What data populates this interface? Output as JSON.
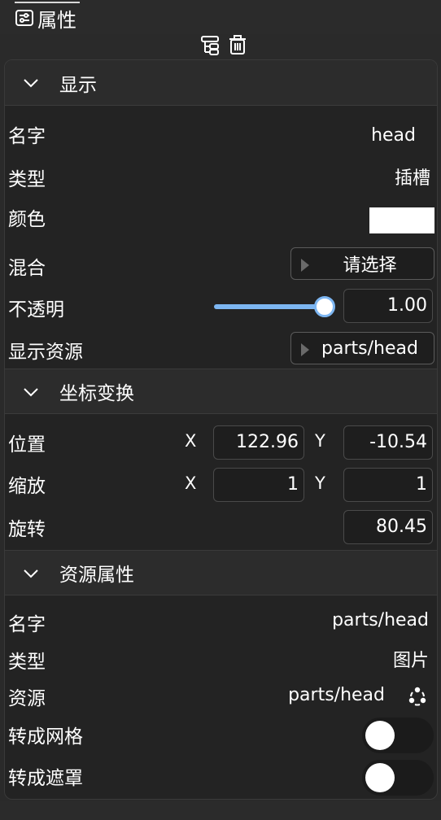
{
  "tab": {
    "label": "属性"
  },
  "sections": {
    "display": {
      "title": "显示",
      "name_label": "名字",
      "name_value": "head",
      "type_label": "类型",
      "type_value": "插槽",
      "color_label": "颜色",
      "color_value": "#ffffff",
      "blend_label": "混合",
      "blend_value": "请选择",
      "opacity_label": "不透明",
      "opacity_value": "1.00",
      "opacity_level": 1.0,
      "resource_label": "显示资源",
      "resource_value": "parts/head"
    },
    "transform": {
      "title": "坐标变换",
      "position_label": "位置",
      "pos_x_axis": "X",
      "pos_x": "122.96",
      "pos_y_axis": "Y",
      "pos_y": "-10.54",
      "scale_label": "缩放",
      "scale_x_axis": "X",
      "scale_x": "1",
      "scale_y_axis": "Y",
      "scale_y": "1",
      "rotation_label": "旋转",
      "rotation": "80.45"
    },
    "resource": {
      "title": "资源属性",
      "name_label": "名字",
      "name_value": "parts/head",
      "type_label": "类型",
      "type_value": "图片",
      "source_label": "资源",
      "source_value": "parts/head",
      "to_mesh_label": "转成网格",
      "to_mesh_on": false,
      "to_mask_label": "转成遮罩",
      "to_mask_on": false
    }
  },
  "colors": {
    "accent": "#7db6f2",
    "background": "#232323"
  },
  "icons": [
    "properties-icon",
    "tree-icon",
    "trash-icon",
    "chevron-down-icon",
    "refresh-icon"
  ]
}
